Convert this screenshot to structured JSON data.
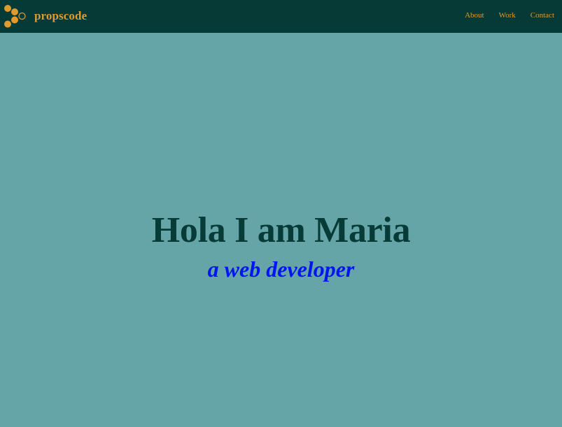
{
  "navbar": {
    "brand": {
      "logo_icon": "hexagon-dots-logo-icon",
      "name": "propscode"
    },
    "links": [
      {
        "label": "About"
      },
      {
        "label": "Work"
      },
      {
        "label": "Contact"
      }
    ]
  },
  "hero": {
    "title": "Hola I am Maria",
    "subtitle": "a web developer"
  },
  "colors": {
    "navbar_bg": "#053a36",
    "accent": "#e09a2e",
    "page_bg": "#65a5a8",
    "title": "#073b37",
    "subtitle": "#0015f0"
  }
}
